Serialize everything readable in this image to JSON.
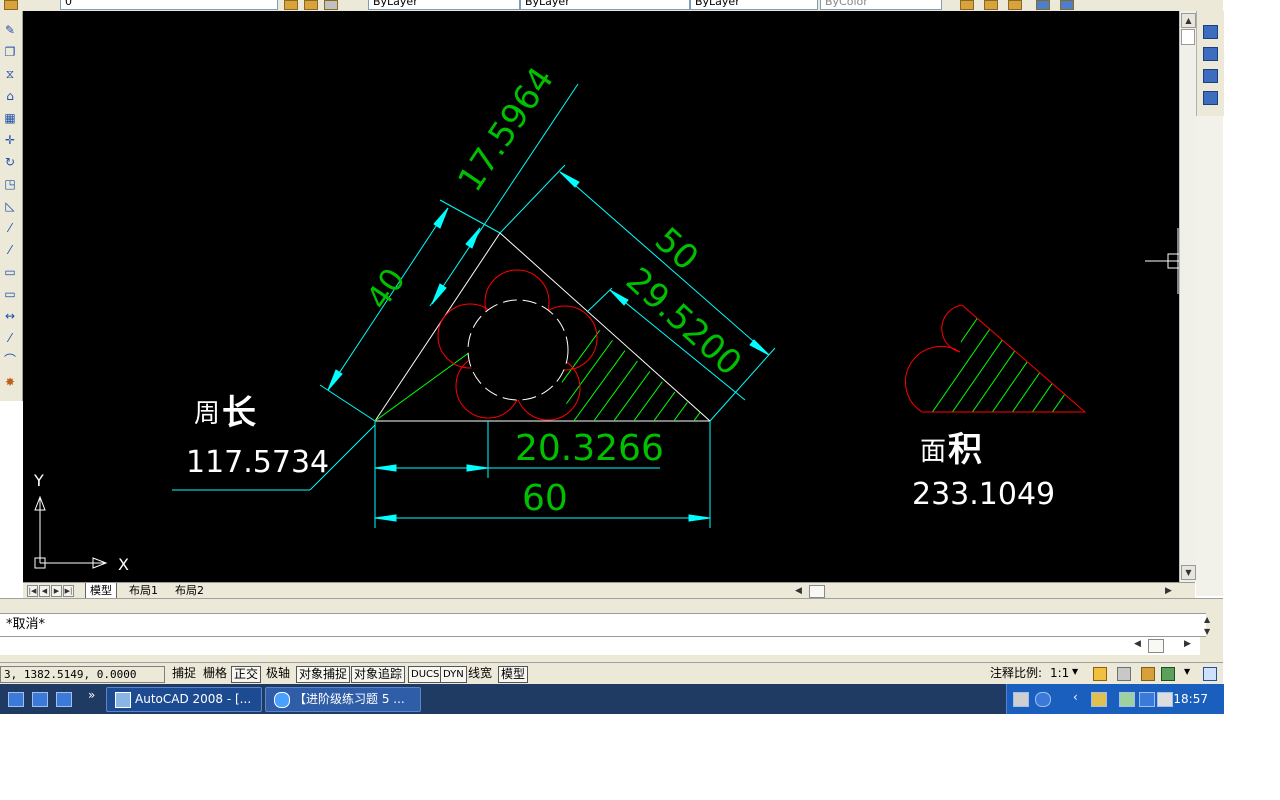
{
  "toolbar": {
    "layer_field": "0",
    "color_field": "ByLayer",
    "linetype_field": "ByLayer",
    "lineweight_field": "ByLayer",
    "plotstyle_field": "ByColor"
  },
  "drawing": {
    "dims": {
      "d40": "40",
      "d17": "17.5964",
      "d50": "50",
      "d29": "29.5200",
      "d20": "20.3266",
      "d60": "60"
    },
    "perimeter_label_small": "周",
    "perimeter_label_big": "长",
    "perimeter_value": "117.5734",
    "area_label_small": "面",
    "area_label_big": "积",
    "area_value": "233.1049",
    "ucs_x": "X",
    "ucs_y": "Y",
    "colors": {
      "canvas": "#000000",
      "dimension": "#00ffff",
      "dim_text": "#00c000",
      "geometry": "#ffffff",
      "circles": "#ff0000",
      "hatch": "#00ff00"
    }
  },
  "tabs": [
    "模型",
    "布局1",
    "布局2"
  ],
  "command_line": {
    "history": "*取消*"
  },
  "status_bar": {
    "coordinates": "3, 1382.5149, 0.0000",
    "buttons": [
      "捕捉",
      "栅格",
      "正交",
      "极轴",
      "对象捕捉",
      "对象追踪",
      "DUCS",
      "DYN",
      "线宽",
      "模型"
    ],
    "annotation_scale_label": "注释比例:",
    "annotation_scale_value": "1:1"
  },
  "taskbar": {
    "task1": "AutoCAD 2008 - [...",
    "task2": "【进阶级练习题 5 ...",
    "clock": "18:57"
  }
}
